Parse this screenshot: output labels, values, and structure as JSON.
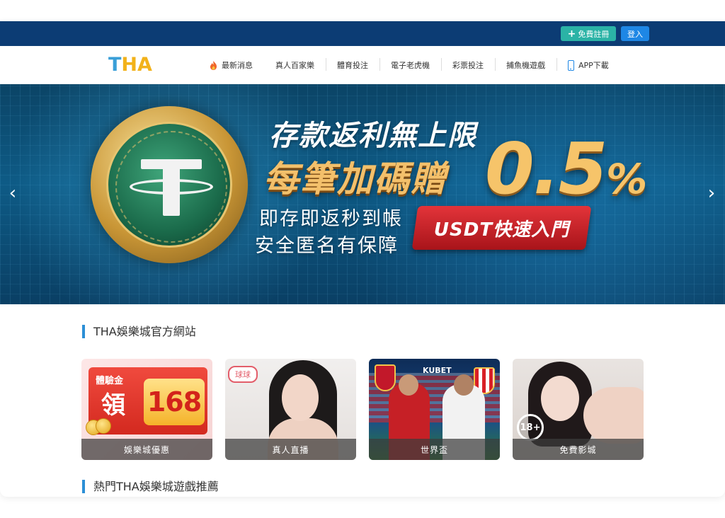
{
  "topbar": {
    "register_label": "免費註冊",
    "login_label": "登入"
  },
  "logo": {
    "t": "T",
    "ha": "HA"
  },
  "nav": {
    "items": [
      {
        "label": "最新消息",
        "icon": "fire-icon"
      },
      {
        "label": "真人百家樂"
      },
      {
        "label": "體育投注"
      },
      {
        "label": "電子老虎機"
      },
      {
        "label": "彩票投注"
      },
      {
        "label": "捕魚機遊戲"
      },
      {
        "label": "APP下載",
        "icon": "phone-icon"
      }
    ]
  },
  "banner": {
    "title1": "存款返利無上限",
    "title2": "每筆加碼贈",
    "percent": "0.5",
    "percent_sign": "%",
    "sub1": "即存即返秒到帳",
    "sub2": "安全匿名有保障",
    "cta": "USDT快速入門",
    "prev_icon": "‹",
    "next_icon": "›"
  },
  "section1": {
    "title": "THA娛樂城官方網站"
  },
  "cards": [
    {
      "caption": "娛樂城優惠",
      "tag": "體驗金",
      "big": "領",
      "num": "168"
    },
    {
      "caption": "真人直播",
      "badge": "球球"
    },
    {
      "caption": "世界盃",
      "logo": "KUBET"
    },
    {
      "caption": "免費影城",
      "badge": "18+"
    }
  ],
  "section2": {
    "title": "熱門THA娛樂城遊戲推薦"
  },
  "colors": {
    "topbar": "#0c3c74",
    "register": "#2bb3a6",
    "login": "#1e87e5",
    "accent": "#2c8fd6",
    "logo_t": "#3a9fd8",
    "logo_ha": "#f2b21a"
  }
}
